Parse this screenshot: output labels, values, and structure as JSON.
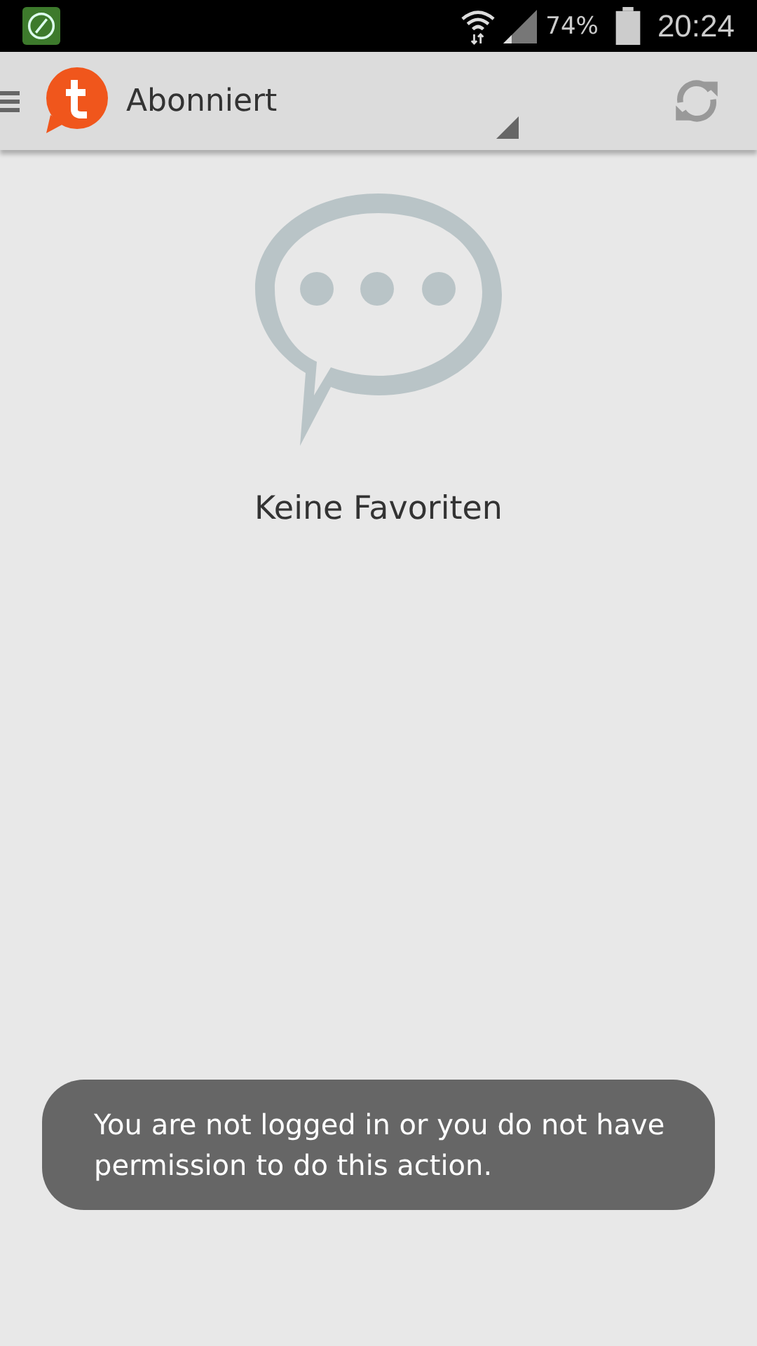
{
  "status_bar": {
    "battery": "74%",
    "time": "20:24"
  },
  "app_bar": {
    "title": "Abonniert"
  },
  "empty_state": {
    "message": "Keine Favoriten"
  },
  "toast": {
    "message": "You are not logged in or you do not have permission to do this action."
  }
}
